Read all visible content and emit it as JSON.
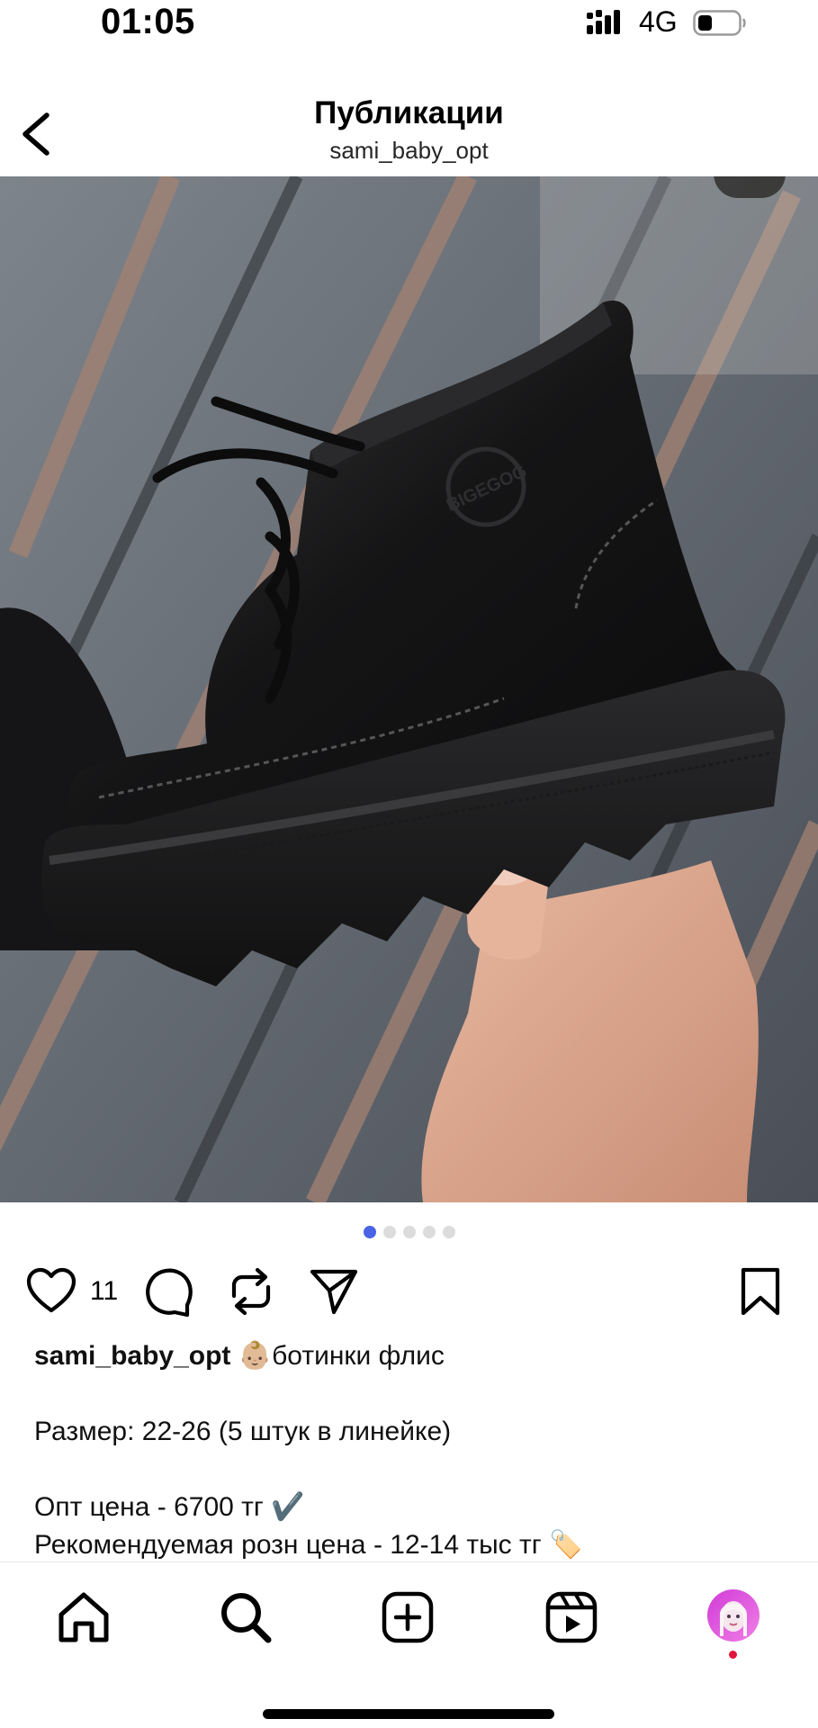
{
  "status_bar": {
    "time": "01:05",
    "network": "4G"
  },
  "header": {
    "title": "Публикации",
    "username": "sami_baby_opt"
  },
  "post": {
    "image_description": "black leather kids ankle boot held in hand",
    "brand_stamp": "BIGEGOG",
    "carousel": {
      "count": 5,
      "active_index": 0
    },
    "likes": "11",
    "caption": {
      "username": "sami_baby_opt",
      "first_line": "👶🏼ботинки флис",
      "lines": [
        "Размер: 22-26 (5 штук в линейке)",
        "Опт цена -  6700 тг ✔️",
        "Рекомендуемая розн цена - 12-14 тыс тг 🏷️"
      ]
    }
  },
  "tabbar": {
    "items": [
      {
        "icon": "home-icon"
      },
      {
        "icon": "search-icon"
      },
      {
        "icon": "create-icon"
      },
      {
        "icon": "reels-icon"
      },
      {
        "icon": "profile-avatar"
      }
    ]
  },
  "colors": {
    "accent": "#4a63e6",
    "notification": "#e1163c"
  }
}
